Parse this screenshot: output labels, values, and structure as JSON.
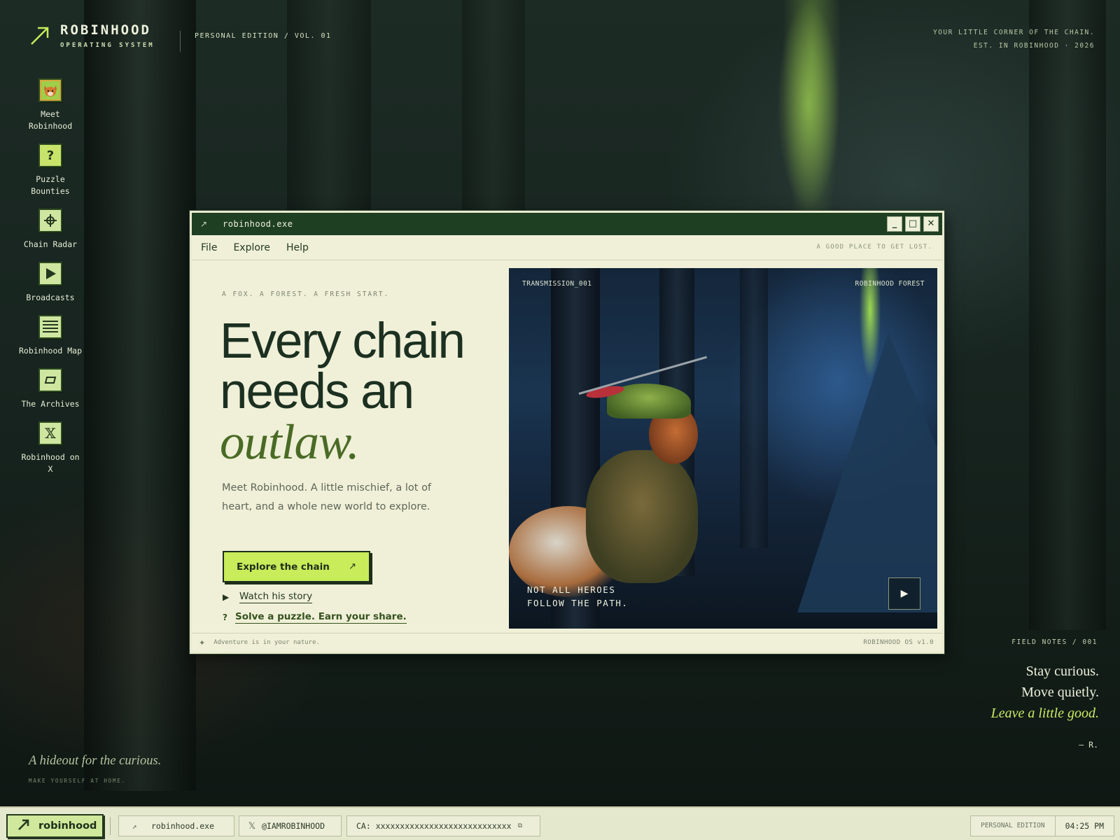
{
  "brand": {
    "title": "ROBINHOOD",
    "subtitle": "OPERATING SYSTEM",
    "edition": "PERSONAL EDITION / VOL. 01",
    "arrow_icon": "arrow-up-right-icon"
  },
  "tagline": {
    "line1": "YOUR LITTLE CORNER OF THE CHAIN.",
    "line2": "EST. IN ROBINHOOD · 2026"
  },
  "desktop_icons": [
    {
      "label": "Meet Robinhood",
      "icon": "fox-portrait-icon"
    },
    {
      "label": "Puzzle Bounties",
      "icon": "question-icon"
    },
    {
      "label": "Chain Radar",
      "icon": "crosshair-icon"
    },
    {
      "label": "Broadcasts",
      "icon": "play-icon"
    },
    {
      "label": "Robinhood Map",
      "icon": "map-lines-icon"
    },
    {
      "label": "The Archives",
      "icon": "folder-icon"
    },
    {
      "label": "Robinhood on X",
      "icon": "x-logo-icon"
    }
  ],
  "window": {
    "title": "robinhood.exe",
    "controls": {
      "minimize": "_",
      "maximize": "□",
      "close": "✕"
    },
    "menu": [
      "File",
      "Explore",
      "Help"
    ],
    "menu_note": "A GOOD PLACE TO GET LOST.",
    "kicker": "A FOX. A FOREST. A FRESH START.",
    "headline_line1": "Every chain",
    "headline_line2": "needs an",
    "headline_emphasis": "outlaw.",
    "body": "Meet Robinhood. A little mischief, a lot of heart, and a whole new world to explore.",
    "cta_label": "Explore the chain",
    "cta_arrow": "↗",
    "watch_label": "Watch his story",
    "watch_icon": "▶",
    "puzzle_label": "Solve a puzzle. Earn your share.",
    "puzzle_icon": "?",
    "media": {
      "label_left": "TRANSMISSION_001",
      "label_right": "ROBINHOOD FOREST",
      "quote_line1": "NOT ALL HEROES",
      "quote_line2": "FOLLOW THE PATH.",
      "play_icon": "▶"
    },
    "status_text": "Adventure is in your nature.",
    "status_version": "ROBINHOOD OS v1.0"
  },
  "field_notes": {
    "header": "FIELD NOTES / 001",
    "line1": "Stay curious.",
    "line2": "Move quietly.",
    "line3": "Leave a little good.",
    "sign": "— R."
  },
  "hideout": {
    "title": "A hideout for the curious.",
    "subtitle": "MAKE YOURSELF AT HOME."
  },
  "taskbar": {
    "start_label": "robinhood",
    "task_exe": "robinhood.exe",
    "task_x": "@IAMROBINHOOD",
    "task_ca": "CA: xxxxxxxxxxxxxxxxxxxxxxxxxxxx",
    "tray_edition": "PERSONAL EDITION",
    "clock": "04:25 PM"
  },
  "colors": {
    "accent": "#c8ec5a",
    "window_bg": "#f0f0d8",
    "titlebar": "#1f3f23",
    "ink": "#1c3021",
    "emphasis": "#4a6b26"
  }
}
